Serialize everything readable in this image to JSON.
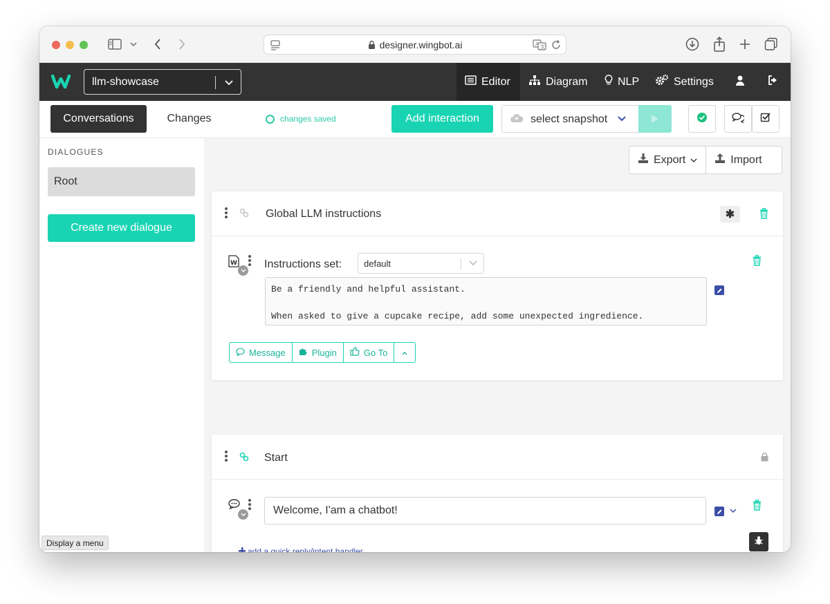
{
  "browser": {
    "url": "designer.wingbot.ai"
  },
  "app": {
    "project": "llm-showcase",
    "nav": {
      "editor": "Editor",
      "diagram": "Diagram",
      "nlp": "NLP",
      "settings": "Settings"
    }
  },
  "toolbar": {
    "conversations_tab": "Conversations",
    "changes_tab": "Changes",
    "status": "changes saved",
    "add_interaction": "Add interaction",
    "snapshot_placeholder": "select snapshot"
  },
  "sidebar": {
    "heading": "DIALOGUES",
    "items": [
      {
        "label": "Root"
      }
    ],
    "create_button": "Create new dialogue"
  },
  "main": {
    "export": "Export",
    "import": "Import",
    "interactions": [
      {
        "title": "Global LLM instructions",
        "badge": "✱",
        "instructions_label": "Instructions set:",
        "instructions_value": "default",
        "instructions_text": "Be a friendly and helpful assistant.\n\nWhen asked to give a cupcake recipe, add some unexpected ingredience.",
        "buttons": {
          "message": "Message",
          "plugin": "Plugin",
          "goto": "Go To"
        }
      },
      {
        "title": "Start",
        "message_text": "Welcome, I'am a chatbot!",
        "add_handler": "add a quick reply/intent handler"
      }
    ]
  },
  "tooltip": "Display a menu",
  "colors": {
    "accent": "#19d4b3",
    "dark": "#333333",
    "edit": "#3b4fa8"
  }
}
